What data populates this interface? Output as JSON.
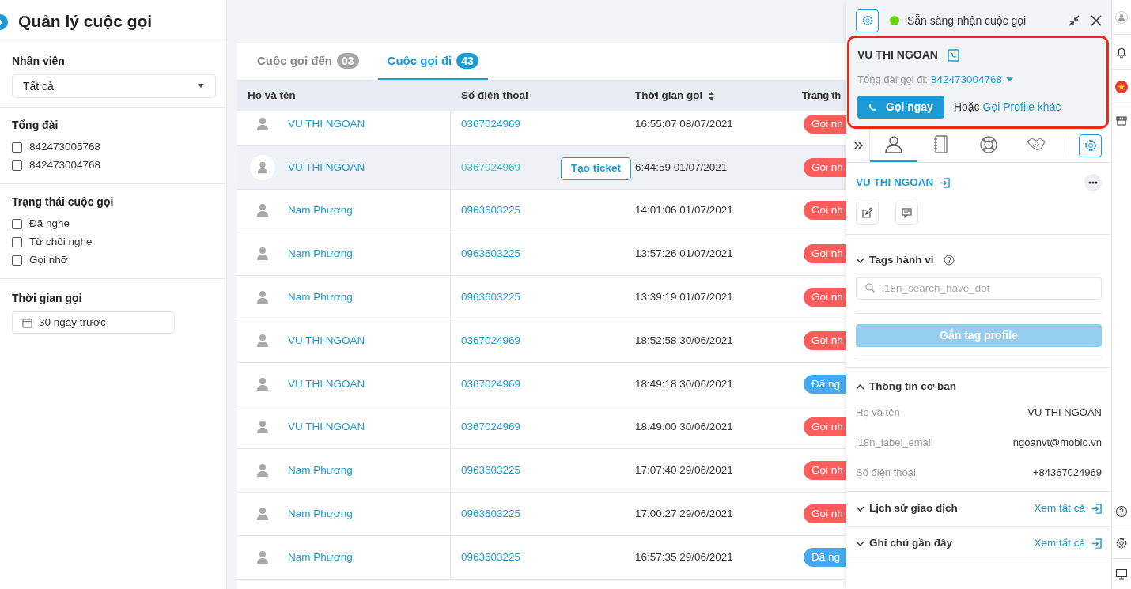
{
  "sidebar": {
    "title": "Quản lý cuộc gọi",
    "filters": [
      {
        "kind": "select",
        "label": "Nhân viên",
        "value": "Tất cả"
      },
      {
        "kind": "checklist",
        "label": "Tổng đài",
        "options": [
          {
            "label": "842473005768",
            "checked": false
          },
          {
            "label": "842473004768",
            "checked": false
          }
        ]
      },
      {
        "kind": "checklist",
        "label": "Trạng thái cuộc gọi",
        "options": [
          {
            "label": "Đã nghe",
            "checked": false
          },
          {
            "label": "Từ chối nghe",
            "checked": false
          },
          {
            "label": "Gọi nhỡ",
            "checked": false
          }
        ]
      },
      {
        "kind": "date",
        "label": "Thời gian gọi",
        "value": "30 ngày trước"
      }
    ]
  },
  "tabs": [
    {
      "label": "Cuộc gọi đến",
      "count": "03",
      "selected": false
    },
    {
      "label": "Cuộc gọi đi",
      "count": "43",
      "selected": true
    }
  ],
  "table": {
    "columns": [
      {
        "label": "Họ và tên",
        "sortable": false
      },
      {
        "label": "Số điện thoại",
        "sortable": false
      },
      {
        "label": "Thời gian gọi",
        "sortable": true
      },
      {
        "label": "Trạng th",
        "sortable": false
      }
    ],
    "rows": [
      {
        "name": "VU THI NGOAN",
        "phone": "0367024969",
        "time": "16:55:07 08/07/2021",
        "status": "Gọi nh",
        "kind": "missed",
        "hovered": false
      },
      {
        "name": "VU THI NGOAN",
        "phone": "0367024969",
        "time": "6:44:59 01/07/2021",
        "status": "Gọi nh",
        "kind": "missed",
        "hovered": true,
        "action": "Tạo ticket"
      },
      {
        "name": "Nam Phương",
        "phone": "0963603225",
        "time": "14:01:06 01/07/2021",
        "status": "Gọi nh",
        "kind": "missed",
        "hovered": false
      },
      {
        "name": "Nam Phương",
        "phone": "0963603225",
        "time": "13:57:26 01/07/2021",
        "status": "Gọi nh",
        "kind": "missed",
        "hovered": false
      },
      {
        "name": "Nam Phương",
        "phone": "0963603225",
        "time": "13:39:19 01/07/2021",
        "status": "Gọi nh",
        "kind": "missed",
        "hovered": false
      },
      {
        "name": "VU THI NGOAN",
        "phone": "0367024969",
        "time": "18:52:58 30/06/2021",
        "status": "Gọi nh",
        "kind": "missed",
        "hovered": false
      },
      {
        "name": "VU THI NGOAN",
        "phone": "0367024969",
        "time": "18:49:18 30/06/2021",
        "status": "Đã ng",
        "kind": "answered",
        "hovered": false
      },
      {
        "name": "VU THI NGOAN",
        "phone": "0367024969",
        "time": "18:49:00 30/06/2021",
        "status": "Gọi nh",
        "kind": "missed",
        "hovered": false
      },
      {
        "name": "Nam Phương",
        "phone": "0963603225",
        "time": "17:07:40 29/06/2021",
        "status": "Gọi nh",
        "kind": "missed",
        "hovered": false
      },
      {
        "name": "Nam Phương",
        "phone": "0963603225",
        "time": "17:00:27 29/06/2021",
        "status": "Gọi nh",
        "kind": "missed",
        "hovered": false
      },
      {
        "name": "Nam Phương",
        "phone": "0963603225",
        "time": "16:57:35 29/06/2021",
        "status": "Đã ng",
        "kind": "answered",
        "hovered": false
      }
    ]
  },
  "call_panel": {
    "status": "Sẵn sàng nhận cuộc gọi",
    "online": true,
    "contact": {
      "name": "VU THI NGOAN",
      "line_label": "Tổng đài gọi đi:",
      "line": "842473004768",
      "call_button": "Gọi ngay",
      "or_text": "Hoặc",
      "other_link": "Gọi Profile khác"
    },
    "tabs": [
      {
        "kind": "person",
        "selected": true
      },
      {
        "kind": "notebook",
        "selected": false
      },
      {
        "kind": "lifebuoy",
        "selected": false
      },
      {
        "kind": "handshake",
        "selected": false
      }
    ],
    "profile": {
      "name": "VU THI NGOAN"
    },
    "tags": {
      "title": "Tags hành vi",
      "search_placeholder": "i18n_search_have_dot",
      "button": "Gắn tag profile",
      "button_disabled": true
    },
    "basic_info": {
      "title": "Thông tin cơ bản",
      "expanded": true,
      "fields": [
        {
          "label": "Họ và tên",
          "value": "VU THI NGOAN"
        },
        {
          "label": "i18n_label_email",
          "value": "ngoanvt@mobio.vn"
        },
        {
          "label": "Số điện thoại",
          "value": "+84367024969"
        }
      ]
    },
    "sections": [
      {
        "title": "Lịch sử giao dịch",
        "expanded": false,
        "link": "Xem tất cả"
      },
      {
        "title": "Ghi chú gần đây",
        "expanded": false,
        "link": "Xem tất cả"
      }
    ]
  }
}
